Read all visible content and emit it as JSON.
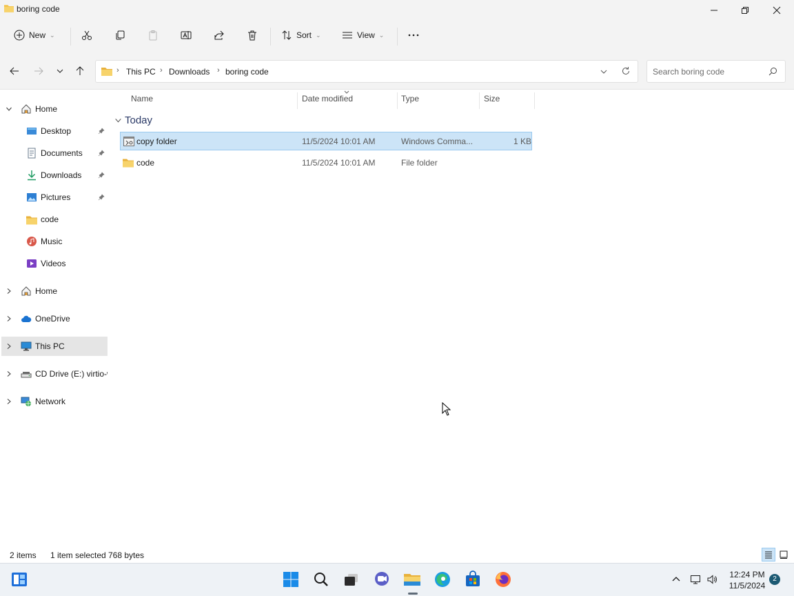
{
  "window": {
    "title": "boring code",
    "icon": "folder-icon",
    "controls": [
      "minimize-icon",
      "maximize-icon",
      "close-icon"
    ]
  },
  "toolbar": {
    "new_label": "New",
    "sort_label": "Sort",
    "view_label": "View",
    "icons": [
      "cut-icon",
      "copy-icon",
      "paste-icon",
      "rename-icon",
      "share-icon",
      "delete-icon",
      "more-icon"
    ]
  },
  "address": {
    "crumbs": [
      "This PC",
      "Downloads",
      "boring code"
    ],
    "search_placeholder": "Search boring code"
  },
  "nav": {
    "quick_access": [
      {
        "label": "Home",
        "icon": "home-icon"
      },
      {
        "label": "Desktop",
        "icon": "desktop-icon",
        "pinned": true
      },
      {
        "label": "Documents",
        "icon": "documents-icon",
        "pinned": true
      },
      {
        "label": "Downloads",
        "icon": "downloads-icon",
        "pinned": true
      },
      {
        "label": "Pictures",
        "icon": "pictures-icon",
        "pinned": true
      },
      {
        "label": "code",
        "icon": "folder-icon"
      },
      {
        "label": "Music",
        "icon": "music-icon"
      },
      {
        "label": "Videos",
        "icon": "videos-icon"
      }
    ],
    "roots": [
      {
        "label": "Home",
        "icon": "home-icon"
      },
      {
        "label": "OneDrive",
        "icon": "cloud-icon"
      },
      {
        "label": "This PC",
        "icon": "computer-icon",
        "selected": true
      },
      {
        "label": "CD Drive (E:) virtio-w",
        "icon": "cd-drive-icon"
      },
      {
        "label": "Network",
        "icon": "network-icon"
      }
    ]
  },
  "content": {
    "columns": [
      "Name",
      "Date modified",
      "Type",
      "Size"
    ],
    "group": "Today",
    "rows": [
      {
        "name": "copy folder",
        "date": "11/5/2024 10:01 AM",
        "type": "Windows Comma...",
        "size": "1 KB",
        "icon": "batch-file-icon",
        "selected": true
      },
      {
        "name": "code",
        "date": "11/5/2024 10:01 AM",
        "type": "File folder",
        "size": "",
        "icon": "folder-icon",
        "selected": false
      }
    ]
  },
  "status": {
    "items": "2 items",
    "selected": "1 item selected",
    "size": "768 bytes"
  },
  "taskbar": {
    "apps": [
      "widgets-icon",
      "start-icon",
      "search-icon",
      "task-view-icon",
      "chat-icon",
      "file-explorer-icon",
      "edge-icon",
      "store-icon",
      "firefox-icon"
    ],
    "tray_icons": [
      "chevron-up-icon",
      "network-icon",
      "volume-icon"
    ],
    "time": "12:24 PM",
    "date": "11/5/2024",
    "notifications": "2"
  },
  "colors": {
    "selection": "#cce4f7",
    "selection_border": "#99c9ef",
    "chrome": "#f3f3f3",
    "folder": "#f3c34b"
  }
}
